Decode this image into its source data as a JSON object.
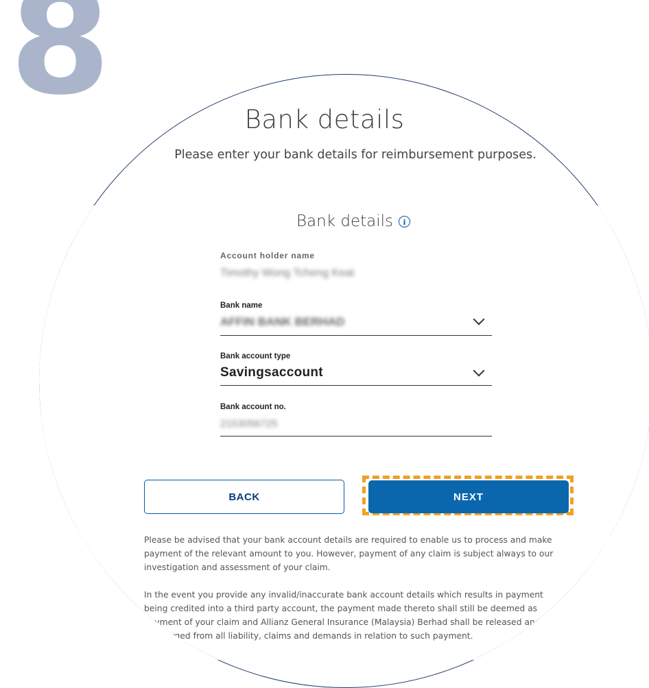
{
  "step": {
    "number": "8"
  },
  "header": {
    "title": "Bank details",
    "subtitle": "Please enter your bank details for reimbursement purposes."
  },
  "section": {
    "title": "Bank details",
    "info_icon": "info-circle-icon"
  },
  "form": {
    "account_holder": {
      "label": "Account holder name",
      "value": "Timothy Wong Tcheng Keat"
    },
    "bank_name": {
      "label": "Bank name",
      "value": "AFFIN BANK BERHAD"
    },
    "account_type": {
      "label": "Bank account type",
      "value": "Savingsaccount"
    },
    "account_no": {
      "label": "Bank account no.",
      "value": "2153056725"
    }
  },
  "buttons": {
    "back": "BACK",
    "next": "NEXT"
  },
  "disclaimer": {
    "para1": "Please be advised that your bank account details are required to enable us to process and make payment of the relevant amount to you. However, payment of any claim is subject always to our investigation and assessment of your claim.",
    "para2": "In the event you provide any invalid/inaccurate bank account details which results in payment being credited into a third party account, the payment made thereto shall still be deemed as payment of your claim and Allianz General Insurance (Malaysia) Berhad shall be released and discharged from all liability, claims and demands in relation to such payment."
  },
  "colors": {
    "brand_blue": "#0a67ad",
    "highlight_orange": "#f2a024",
    "step_number": "#aab5cb",
    "circle_outline": "#1f3a6e"
  }
}
